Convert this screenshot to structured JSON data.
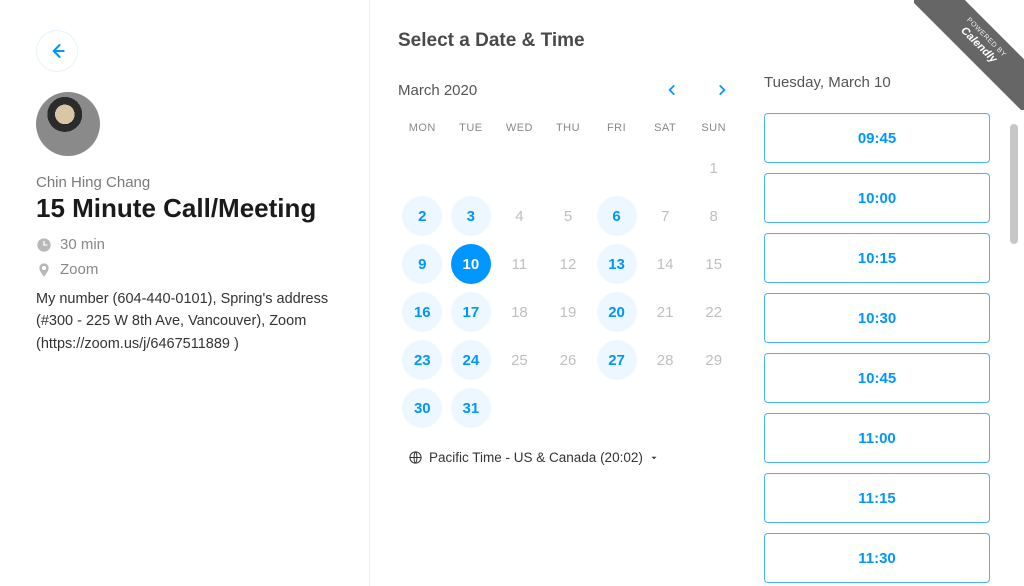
{
  "ribbon": {
    "powered_by": "POWERED BY",
    "brand": "Calendly"
  },
  "host": {
    "name": "Chin Hing Chang"
  },
  "event": {
    "title": "15 Minute Call/Meeting",
    "duration": "30 min",
    "location": "Zoom",
    "description": "My number (604-440-0101), Spring's address (#300 - 225 W 8th Ave, Vancouver), Zoom (https://zoom.us/j/6467511889 )"
  },
  "section_title": "Select a Date & Time",
  "calendar": {
    "month_label": "March 2020",
    "weekdays": [
      "MON",
      "TUE",
      "WED",
      "THU",
      "FRI",
      "SAT",
      "SUN"
    ],
    "weeks": [
      [
        {
          "d": "",
          "a": false
        },
        {
          "d": "",
          "a": false
        },
        {
          "d": "",
          "a": false
        },
        {
          "d": "",
          "a": false
        },
        {
          "d": "",
          "a": false
        },
        {
          "d": "",
          "a": false
        },
        {
          "d": "1",
          "a": false
        }
      ],
      [
        {
          "d": "2",
          "a": true
        },
        {
          "d": "3",
          "a": true
        },
        {
          "d": "4",
          "a": false
        },
        {
          "d": "5",
          "a": false
        },
        {
          "d": "6",
          "a": true
        },
        {
          "d": "7",
          "a": false
        },
        {
          "d": "8",
          "a": false
        }
      ],
      [
        {
          "d": "9",
          "a": true
        },
        {
          "d": "10",
          "a": true,
          "selected": true
        },
        {
          "d": "11",
          "a": false
        },
        {
          "d": "12",
          "a": false
        },
        {
          "d": "13",
          "a": true
        },
        {
          "d": "14",
          "a": false
        },
        {
          "d": "15",
          "a": false
        }
      ],
      [
        {
          "d": "16",
          "a": true
        },
        {
          "d": "17",
          "a": true
        },
        {
          "d": "18",
          "a": false
        },
        {
          "d": "19",
          "a": false
        },
        {
          "d": "20",
          "a": true
        },
        {
          "d": "21",
          "a": false
        },
        {
          "d": "22",
          "a": false
        }
      ],
      [
        {
          "d": "23",
          "a": true
        },
        {
          "d": "24",
          "a": true
        },
        {
          "d": "25",
          "a": false
        },
        {
          "d": "26",
          "a": false
        },
        {
          "d": "27",
          "a": true
        },
        {
          "d": "28",
          "a": false
        },
        {
          "d": "29",
          "a": false
        }
      ],
      [
        {
          "d": "30",
          "a": true
        },
        {
          "d": "31",
          "a": true
        },
        {
          "d": "",
          "a": false
        },
        {
          "d": "",
          "a": false
        },
        {
          "d": "",
          "a": false
        },
        {
          "d": "",
          "a": false
        },
        {
          "d": "",
          "a": false
        }
      ]
    ],
    "timezone": "Pacific Time - US & Canada (20:02)"
  },
  "selected_date": "Tuesday, March 10",
  "timeslots": [
    "09:45",
    "10:00",
    "10:15",
    "10:30",
    "10:45",
    "11:00",
    "11:15",
    "11:30"
  ]
}
